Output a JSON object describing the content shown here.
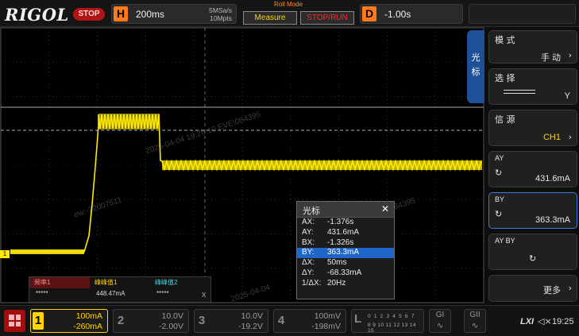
{
  "top": {
    "logo": "RIGOL",
    "status": "STOP",
    "horizontal": {
      "key": "H",
      "timebase": "200ms",
      "sample_rate": "5MSa/s",
      "memory_depth": "10Mpts"
    },
    "mode_label": "Roll Mode",
    "measure_button": "Measure",
    "stoprun_button": "STOP/RUN",
    "delay": {
      "key": "D",
      "value": "-1.00s"
    }
  },
  "watermarks": [
    "2025-04-04  19:26:10  EVE\\084395",
    "ew:-22007511",
    "EVE\\084395",
    "2025-04-04"
  ],
  "channel_marker": "1",
  "cursor_dialog": {
    "title": "光标",
    "close": "✕",
    "rows": [
      {
        "k": "AX:",
        "v": "-1.376s"
      },
      {
        "k": "AY:",
        "v": "431.6mA"
      },
      {
        "k": "BX:",
        "v": "-1.326s"
      },
      {
        "k": "BY:",
        "v": "363.3mA"
      },
      {
        "k": "ΔX:",
        "v": "50ms"
      },
      {
        "k": "ΔY:",
        "v": "-68.33mA"
      },
      {
        "k": "1/ΔX:",
        "v": "20Hz"
      }
    ]
  },
  "measurements": {
    "headers": [
      "频率1",
      "峰峰值1",
      "峰峰值2"
    ],
    "values": [
      "*****",
      "448.47mA",
      "*****"
    ],
    "header_colors": [
      "#e23a3a",
      "#ffd400",
      "#3fd6d6"
    ],
    "x_label": "X"
  },
  "menu": {
    "side_tab": [
      "光",
      "标"
    ],
    "items": [
      {
        "label": "模 式",
        "value": "手 动"
      },
      {
        "label": "选 择",
        "value": "Y"
      },
      {
        "label": "信 源",
        "value": "CH1"
      },
      {
        "label": "AY",
        "value": "431.6mA"
      },
      {
        "label": "BY",
        "value": "363.3mA"
      },
      {
        "label": "AY BY",
        "value": ""
      },
      {
        "label": "",
        "value": "更多"
      }
    ]
  },
  "bottom": {
    "channels": [
      {
        "num": "1",
        "scale": "100mA",
        "offset": "-260mA"
      },
      {
        "num": "2",
        "scale": "10.0V",
        "offset": "-2.00V"
      },
      {
        "num": "3",
        "scale": "10.0V",
        "offset": "-19.2V"
      },
      {
        "num": "4",
        "scale": "100mV",
        "offset": "-198mV"
      }
    ],
    "digital": {
      "letter": "L",
      "row1": "0 1 2 3  4 5 6 7",
      "row2": "8 9 10 11 12 13 14 15"
    },
    "g1": "GI",
    "g2": "GII",
    "lxi": "LXI",
    "clock": "19:25"
  },
  "colors": {
    "ch1": "#ffd400",
    "accent": "#1f66c8",
    "stop": "#b01414"
  }
}
